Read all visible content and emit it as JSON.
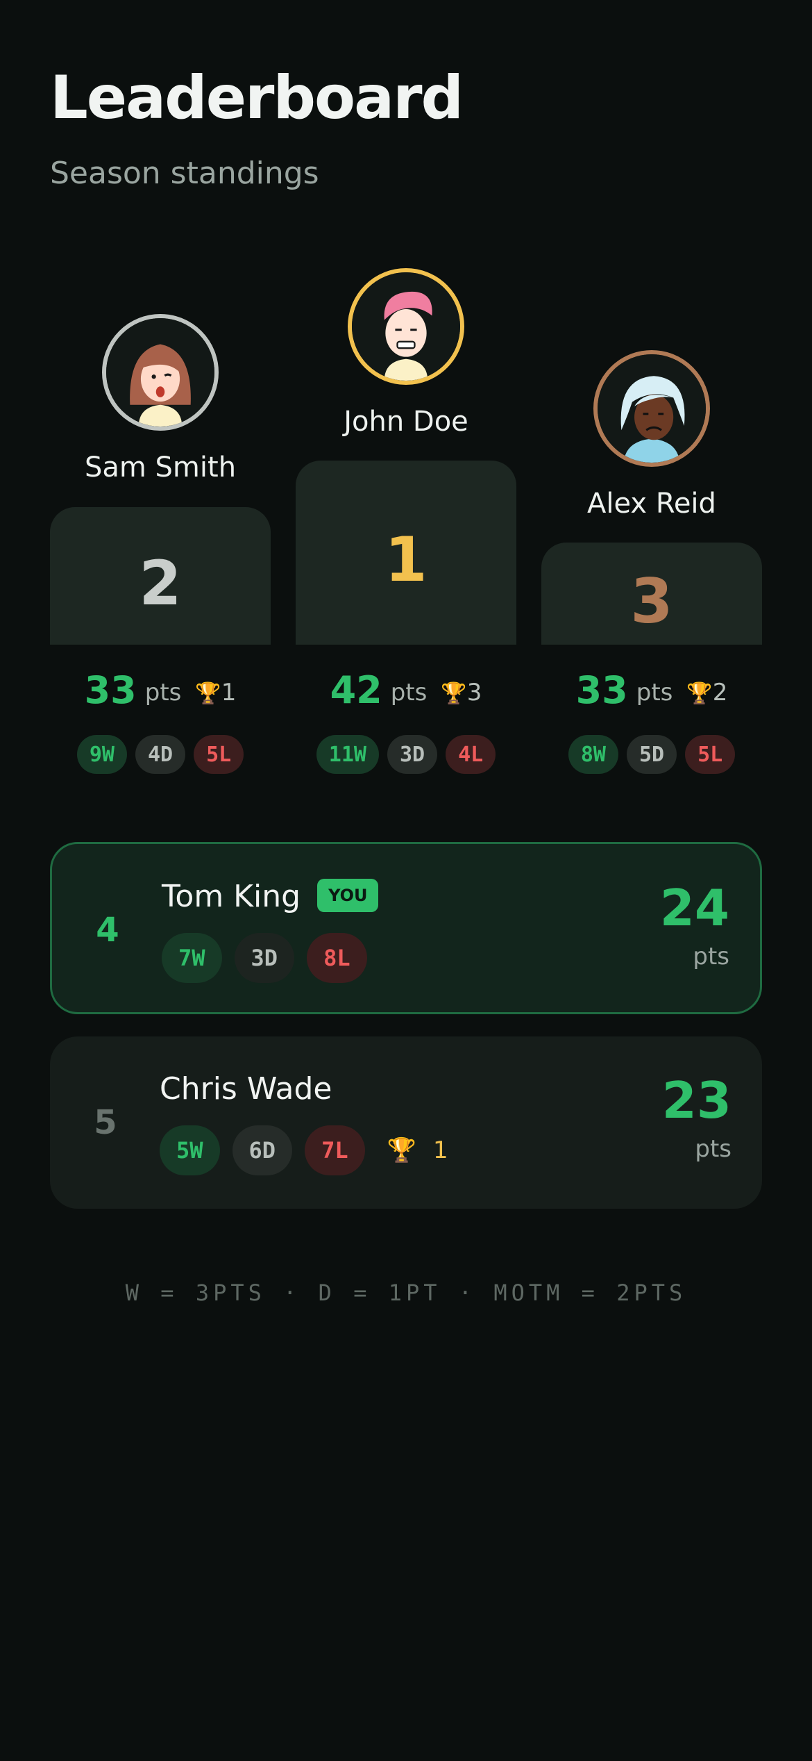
{
  "header": {
    "title": "Leaderboard",
    "subtitle": "Season standings"
  },
  "podium": {
    "second": {
      "rank": "2",
      "name": "Sam Smith",
      "points": "33",
      "points_label": "pts",
      "trophy_icon": "trophy-icon",
      "motm": "1",
      "wins": "9W",
      "draws": "4D",
      "losses": "5L",
      "ring_color": "#bfc4c1",
      "rank_color": "#c9cecb"
    },
    "first": {
      "rank": "1",
      "name": "John Doe",
      "points": "42",
      "points_label": "pts",
      "trophy_icon": "trophy-icon",
      "motm": "3",
      "wins": "11W",
      "draws": "3D",
      "losses": "4L",
      "ring_color": "#f2c14e",
      "rank_color": "#f2c14e"
    },
    "third": {
      "rank": "3",
      "name": "Alex Reid",
      "points": "33",
      "points_label": "pts",
      "trophy_icon": "trophy-icon",
      "motm": "2",
      "wins": "8W",
      "draws": "5D",
      "losses": "5L",
      "ring_color": "#b07a55",
      "rank_color": "#b07a55"
    }
  },
  "list": [
    {
      "rank": "4",
      "name": "Tom King",
      "badge": "YOU",
      "wins": "7W",
      "draws": "3D",
      "losses": "8L",
      "points": "24",
      "points_label": "pts",
      "highlight": true
    },
    {
      "rank": "5",
      "name": "Chris Wade",
      "wins": "5W",
      "draws": "6D",
      "losses": "7L",
      "trophy_icon": "trophy-icon",
      "motm": "1",
      "points": "23",
      "points_label": "pts",
      "highlight": false
    }
  ],
  "footer": {
    "legend": "W = 3PTS · D = 1PT · MOTM = 2PTS"
  },
  "colors": {
    "background": "#0b0f0e",
    "accent_green": "#2fbf6a",
    "gold": "#f2c14e",
    "silver": "#bfc4c1",
    "bronze": "#b07a55",
    "loss_red": "#ef5b5b"
  }
}
